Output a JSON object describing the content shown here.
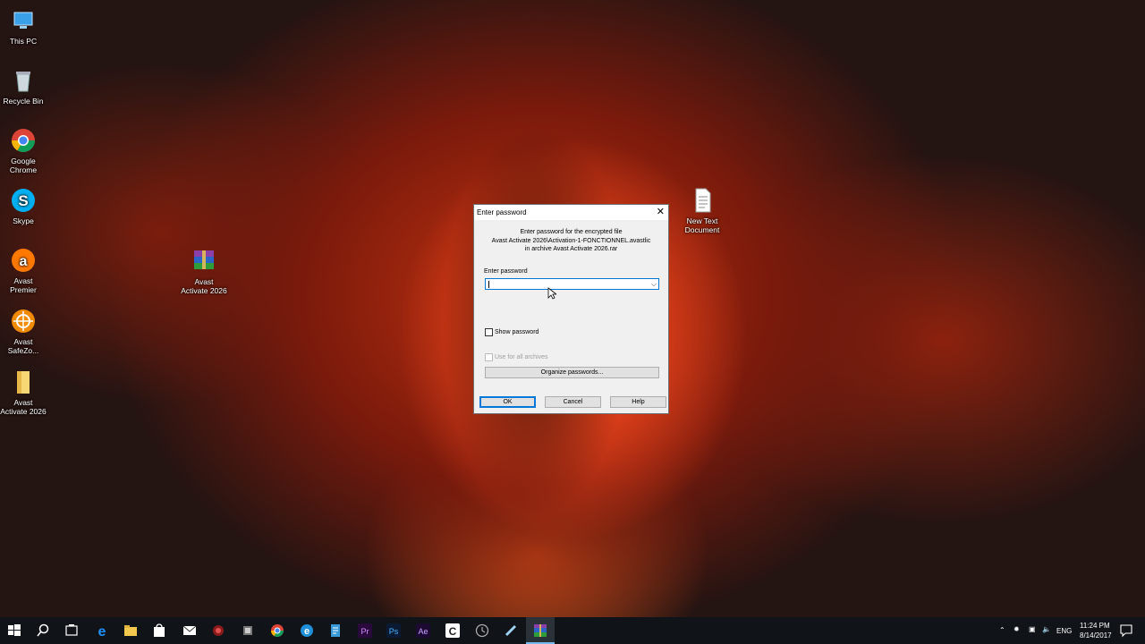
{
  "desktop_icons": [
    {
      "label": "This PC",
      "icon": "computer-icon"
    },
    {
      "label": "Recycle Bin",
      "icon": "recycle-bin-icon"
    },
    {
      "label": "Google Chrome",
      "icon": "chrome-icon"
    },
    {
      "label": "Skype",
      "icon": "skype-icon"
    },
    {
      "label": "Avast Premier",
      "icon": "avast-icon"
    },
    {
      "label": "Avast SafeZo...",
      "icon": "safezone-icon"
    },
    {
      "label": "Avast Activate 2026",
      "icon": "folder-icon"
    },
    {
      "label": "Avast Activate 2026",
      "icon": "winrar-archive-icon"
    },
    {
      "label": "New Text Document",
      "icon": "text-document-icon"
    }
  ],
  "dialog": {
    "title": "Enter password",
    "close": "✕",
    "message_line1": "Enter password for the encrypted file",
    "message_line2": "Avast Activate 2026\\Activation-1-FONCTIONNEL.avastlic",
    "message_line3": "in archive Avast Activate 2026.rar",
    "password_label": "Enter password",
    "password_value": "",
    "show_password": "Show password",
    "use_for_all": "Use for all archives",
    "organize": "Organize passwords...",
    "ok": "OK",
    "cancel": "Cancel",
    "help": "Help"
  },
  "taskbar": {
    "lang": "ENG",
    "time": "11:24 PM",
    "date": "8/14/2017"
  },
  "colors": {
    "accent": "#0078d7",
    "taskbar": "#101419"
  }
}
